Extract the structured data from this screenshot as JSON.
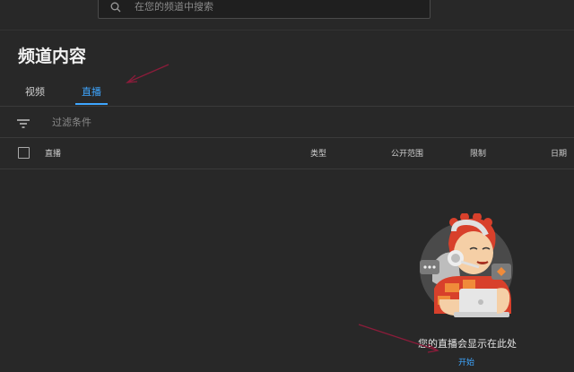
{
  "search": {
    "placeholder": "在您的频道中搜索",
    "icon": "search-icon"
  },
  "page": {
    "title": "频道内容"
  },
  "tabs": [
    {
      "label": "视频",
      "active": false
    },
    {
      "label": "直播",
      "active": true
    }
  ],
  "filter": {
    "icon": "filter-icon",
    "label": "过滤条件"
  },
  "table": {
    "columns": {
      "live": "直播",
      "type": "类型",
      "visibility": "公开范围",
      "restrictions": "限制",
      "date": "日期"
    }
  },
  "empty_state": {
    "message": "您的直播会显示在此处",
    "action_label": "开始"
  },
  "colors": {
    "background": "#282828",
    "accent": "#3ea6ff",
    "annotation": "#8b1c3a"
  }
}
